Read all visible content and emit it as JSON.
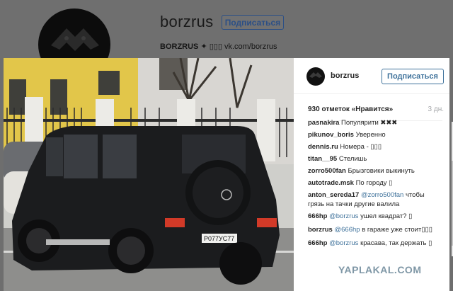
{
  "profile": {
    "username": "borzrus",
    "follow_label": "Подписаться",
    "bio_name": "BORZRUS",
    "bio_symbols": "✦ ▯▯▯",
    "bio_link": "vk.com/borzrus"
  },
  "post": {
    "username": "borzrus",
    "follow_label": "Подписаться",
    "likes": "930 отметок «Нравится»",
    "date": "3 дн.",
    "plate": "Р077УС77",
    "comments": [
      {
        "author": "pasnakira",
        "text": "Популярити ✖✖✖"
      },
      {
        "author": "pikunov_boris",
        "text": "Уверенно"
      },
      {
        "author": "dennis.ru",
        "text": "Номера - ▯▯▯"
      },
      {
        "author": "titan__95",
        "text": "Стелишь"
      },
      {
        "author": "zorro500fan",
        "text": "Брызговики выкинуть"
      },
      {
        "author": "autotrade.msk",
        "text": "По городу ▯"
      },
      {
        "author": "anton_sereda17",
        "mention": "@zorro500fan",
        "text": "чтобы грязь на тачки другие валила"
      },
      {
        "author": "666hp",
        "mention": "@borzrus",
        "text": "ушел квадрат? ▯"
      },
      {
        "author": "borzrus",
        "mention": "@666hp",
        "text": "в гараже уже стоит▯▯▯"
      },
      {
        "author": "666hp",
        "mention": "@borzrus",
        "text": "красава, так держать ▯"
      }
    ]
  },
  "watermark": "YAPLAKAL.COM"
}
